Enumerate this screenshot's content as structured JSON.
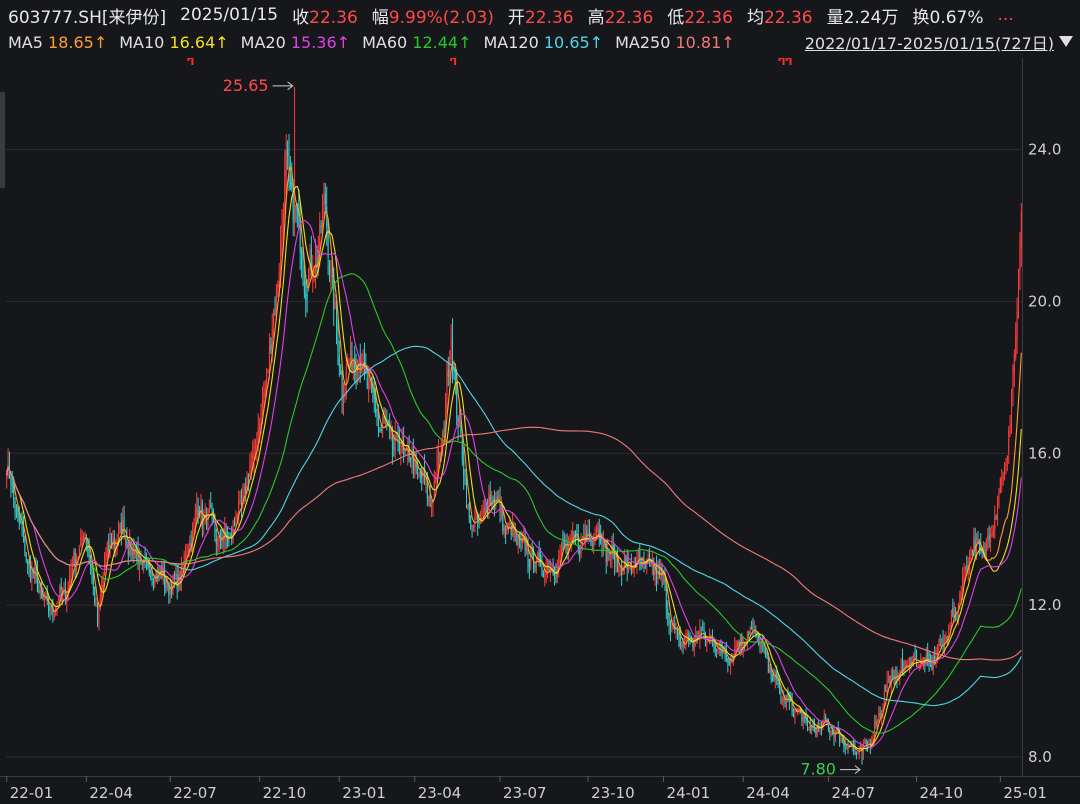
{
  "header": {
    "symbol": "603777.SH[来伊份]",
    "date": "2025/01/15",
    "quote": [
      {
        "label": "收",
        "value": "22.36"
      },
      {
        "label": "幅",
        "value": "9.99%(2.03)"
      },
      {
        "label": "开",
        "value": "22.36"
      },
      {
        "label": "高",
        "value": "22.36"
      },
      {
        "label": "低",
        "value": "22.36"
      },
      {
        "label": "均",
        "value": "22.36"
      },
      {
        "label": "量",
        "value": "2.24万",
        "neutral": true
      },
      {
        "label": "换",
        "value": "0.67%",
        "neutral": true
      }
    ],
    "more": "...",
    "ma": [
      {
        "label": "MA5",
        "value": "18.65↑",
        "color": "#ff9d2e"
      },
      {
        "label": "MA10",
        "value": "16.64↑",
        "color": "#f2e01f"
      },
      {
        "label": "MA20",
        "value": "15.36↑",
        "color": "#e040e6"
      },
      {
        "label": "MA60",
        "value": "12.44↑",
        "color": "#28c828"
      },
      {
        "label": "MA120",
        "value": "10.65↑",
        "color": "#4fd6e6"
      },
      {
        "label": "MA250",
        "value": "10.81↑",
        "color": "#f07a7a"
      }
    ],
    "range": "2022/01/17-2025/01/15(727日)"
  },
  "chart_data": {
    "type": "line",
    "title": "",
    "xlabel": "",
    "ylabel": "",
    "ylim": [
      7.5,
      26.2
    ],
    "yticks": [
      8.0,
      12.0,
      16.0,
      20.0,
      24.0
    ],
    "ytick_labels": [
      "8.0",
      "12.0",
      "16.0",
      "20.0",
      "24.0"
    ],
    "xticks": [
      {
        "label": "22-01",
        "i": 0
      },
      {
        "label": "22-04",
        "i": 57
      },
      {
        "label": "22-07",
        "i": 117
      },
      {
        "label": "22-10",
        "i": 181
      },
      {
        "label": "23-01",
        "i": 238
      },
      {
        "label": "23-04",
        "i": 292
      },
      {
        "label": "23-07",
        "i": 353
      },
      {
        "label": "23-10",
        "i": 416
      },
      {
        "label": "24-01",
        "i": 470
      },
      {
        "label": "24-04",
        "i": 527
      },
      {
        "label": "24-07",
        "i": 588
      },
      {
        "label": "24-10",
        "i": 651
      },
      {
        "label": "25-01",
        "i": 711
      }
    ],
    "n_days": 727,
    "anchors_close": [
      [
        0,
        15.7
      ],
      [
        15,
        13.1
      ],
      [
        30,
        11.8
      ],
      [
        42,
        12.4
      ],
      [
        55,
        13.9
      ],
      [
        60,
        13.2
      ],
      [
        65,
        11.4
      ],
      [
        70,
        13.3
      ],
      [
        82,
        14.0
      ],
      [
        95,
        13.1
      ],
      [
        110,
        12.8
      ],
      [
        118,
        12.4
      ],
      [
        126,
        13.0
      ],
      [
        136,
        14.5
      ],
      [
        146,
        14.2
      ],
      [
        152,
        13.7
      ],
      [
        160,
        13.8
      ],
      [
        172,
        15.2
      ],
      [
        182,
        17.0
      ],
      [
        192,
        19.8
      ],
      [
        200,
        23.5
      ],
      [
        206,
        22.5
      ],
      [
        214,
        20.5
      ],
      [
        220,
        21.0
      ],
      [
        228,
        22.5
      ],
      [
        235,
        19.5
      ],
      [
        240,
        17.8
      ],
      [
        248,
        18.6
      ],
      [
        256,
        18.2
      ],
      [
        266,
        16.8
      ],
      [
        276,
        16.3
      ],
      [
        286,
        16.0
      ],
      [
        296,
        15.4
      ],
      [
        304,
        14.7
      ],
      [
        312,
        16.5
      ],
      [
        318,
        19.0
      ],
      [
        324,
        16.5
      ],
      [
        332,
        14.0
      ],
      [
        340,
        14.3
      ],
      [
        348,
        15.0
      ],
      [
        356,
        14.1
      ],
      [
        366,
        13.7
      ],
      [
        378,
        13.1
      ],
      [
        390,
        12.9
      ],
      [
        400,
        13.6
      ],
      [
        410,
        13.7
      ],
      [
        422,
        14.0
      ],
      [
        430,
        13.4
      ],
      [
        440,
        13.0
      ],
      [
        452,
        13.1
      ],
      [
        462,
        13.0
      ],
      [
        470,
        12.6
      ],
      [
        476,
        11.3
      ],
      [
        484,
        11.0
      ],
      [
        496,
        11.2
      ],
      [
        506,
        11.0
      ],
      [
        516,
        10.6
      ],
      [
        528,
        11.2
      ],
      [
        536,
        11.3
      ],
      [
        546,
        10.3
      ],
      [
        556,
        9.5
      ],
      [
        566,
        9.2
      ],
      [
        576,
        8.7
      ],
      [
        586,
        8.9
      ],
      [
        596,
        8.5
      ],
      [
        606,
        8.2
      ],
      [
        612,
        8.1
      ],
      [
        620,
        8.6
      ],
      [
        630,
        9.9
      ],
      [
        640,
        10.3
      ],
      [
        650,
        10.6
      ],
      [
        660,
        10.4
      ],
      [
        670,
        11.0
      ],
      [
        680,
        12.0
      ],
      [
        690,
        13.6
      ],
      [
        700,
        13.4
      ],
      [
        708,
        14.6
      ],
      [
        716,
        16.0
      ],
      [
        722,
        19.0
      ],
      [
        726,
        22.36
      ]
    ],
    "ma_end_values": {
      "MA5": 18.65,
      "MA10": 16.64,
      "MA20": 15.36,
      "MA60": 12.44,
      "MA120": 10.65,
      "MA250": 10.81
    },
    "series": [
      {
        "name": "MA5",
        "color": "#ff9d2e",
        "window": 5
      },
      {
        "name": "MA10",
        "color": "#f2e01f",
        "window": 10
      },
      {
        "name": "MA20",
        "color": "#e040e6",
        "window": 20
      },
      {
        "name": "MA60",
        "color": "#28c828",
        "window": 60
      },
      {
        "name": "MA120",
        "color": "#4fd6e6",
        "window": 120
      },
      {
        "name": "MA250",
        "color": "#f07a7a",
        "window": 250
      }
    ],
    "annotations": [
      {
        "label": "25.65",
        "i": 206,
        "value": 25.65,
        "color": "#ff4a4a",
        "kind": "max"
      },
      {
        "label": "7.80",
        "i": 612,
        "value": 7.8,
        "color": "#2fd05a",
        "kind": "min"
      }
    ],
    "event_markers": [
      {
        "i": 130,
        "type": "single"
      },
      {
        "i": 318,
        "type": "single"
      },
      {
        "i": 553,
        "type": "double"
      }
    ],
    "colors": {
      "up": "#ff3b3b",
      "down": "#2fd1d1",
      "grid": "#2a2b30",
      "background": "#16171b"
    }
  }
}
